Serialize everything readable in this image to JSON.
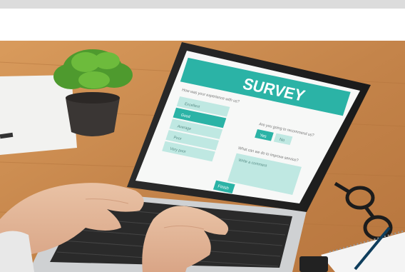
{
  "survey_screen": {
    "title": "SURVEY",
    "question_1": "How was your experience with us?",
    "question_2": "Are you going to recommend us?",
    "question_3": "What can we do to improve service?",
    "options": [
      "Excellent",
      "Good",
      "Average",
      "Poor",
      "Very poor"
    ],
    "yes_label": "Yes",
    "no_label": "No",
    "comment_placeholder": "Write a comment",
    "finish_label": "Finish"
  },
  "colors": {
    "accent": "#2bb3a6",
    "desk": "#c98a4c",
    "top_bar": "#dcdcdc"
  }
}
